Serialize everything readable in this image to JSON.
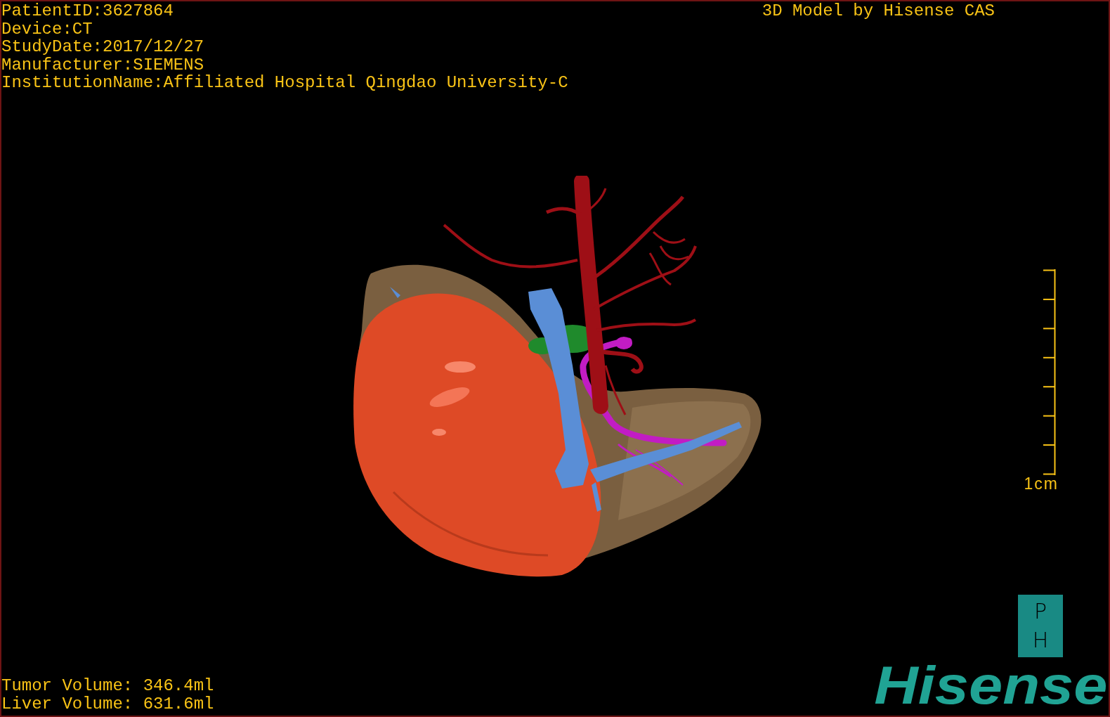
{
  "patient_info": [
    "PatientID:3627864",
    "Device:CT",
    "StudyDate:2017/12/27",
    "Manufacturer:SIEMENS",
    "InstitutionName:Affiliated Hospital Qingdao University-C"
  ],
  "caption": "3D Model by Hisense CAS",
  "scale_bar": {
    "label": "1cm"
  },
  "volumes": [
    "Tumor Volume: 346.4ml",
    "Liver Volume: 631.6ml"
  ],
  "orientation_marker": [
    "P",
    "H"
  ],
  "logo": "Hisense"
}
